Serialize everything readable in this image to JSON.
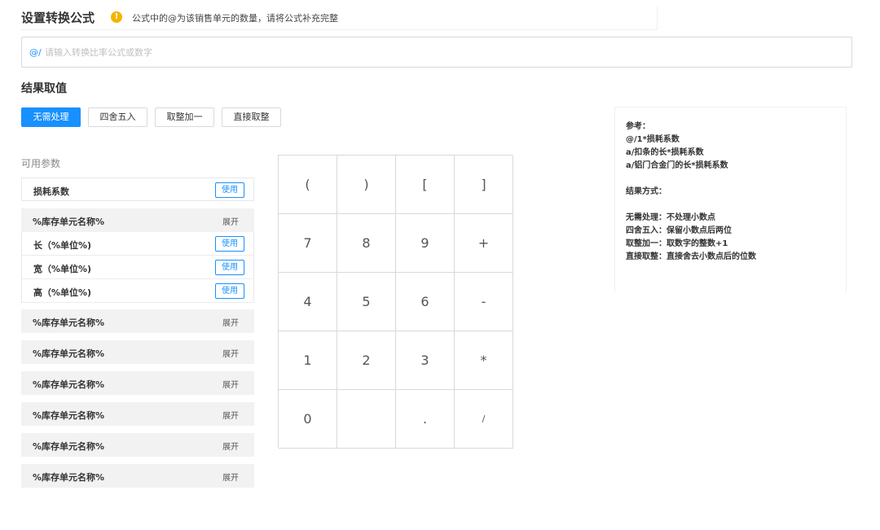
{
  "header": {
    "title": "设置转换公式",
    "warning_icon": "exclamation-circle-icon",
    "warning_text": "公式中的@为该销售单元的数量，请将公式补充完整"
  },
  "formula": {
    "prefix": "@/",
    "value": "",
    "placeholder": "请输入转换比率公式或数字"
  },
  "result": {
    "title": "结果取值",
    "options": [
      "无需处理",
      "四舍五入",
      "取整加一",
      "直接取整"
    ],
    "selected": "无需处理"
  },
  "params": {
    "title": "可用参数",
    "first_item": {
      "label": "损耗系数",
      "action": "使用"
    },
    "expanded_group": {
      "label": "%库存单元名称%",
      "toggle": "展开",
      "items": [
        {
          "label": "长（%单位%)",
          "action": "使用"
        },
        {
          "label": "宽（%单位%)",
          "action": "使用"
        },
        {
          "label": "高（%单位%)",
          "action": "使用"
        }
      ]
    },
    "collapsed_groups": [
      {
        "label": "%库存单元名称%",
        "toggle": "展开"
      },
      {
        "label": "%库存单元名称%",
        "toggle": "展开"
      },
      {
        "label": "%库存单元名称%",
        "toggle": "展开"
      },
      {
        "label": "%库存单元名称%",
        "toggle": "展开"
      },
      {
        "label": "%库存单元名称%",
        "toggle": "展开"
      },
      {
        "label": "%库存单元名称%",
        "toggle": "展开"
      }
    ]
  },
  "keypad": {
    "rows": [
      [
        "(",
        ")",
        "[",
        "]"
      ],
      [
        "7",
        "8",
        "9",
        "+"
      ],
      [
        "4",
        "5",
        "6",
        "-"
      ],
      [
        "1",
        "2",
        "3",
        "*"
      ],
      [
        "0",
        "",
        ".",
        "/"
      ]
    ]
  },
  "reference": {
    "lines": [
      "参考：",
      "@/1*损耗系数",
      "a/扣条的长*损耗系数",
      "a/铝门合金门的长*损耗系数",
      "",
      "结果方式：",
      "",
      "无需处理：不处理小数点",
      "四舍五入：保留小数点后两位",
      "取整加一：取数字的整数+1",
      "直接取整：直接舍去小数点后的位数"
    ]
  },
  "colors": {
    "primary": "#1890ff",
    "warning": "#f5b400",
    "group_bg": "#f2f2f2",
    "border": "#d9d9d9"
  }
}
